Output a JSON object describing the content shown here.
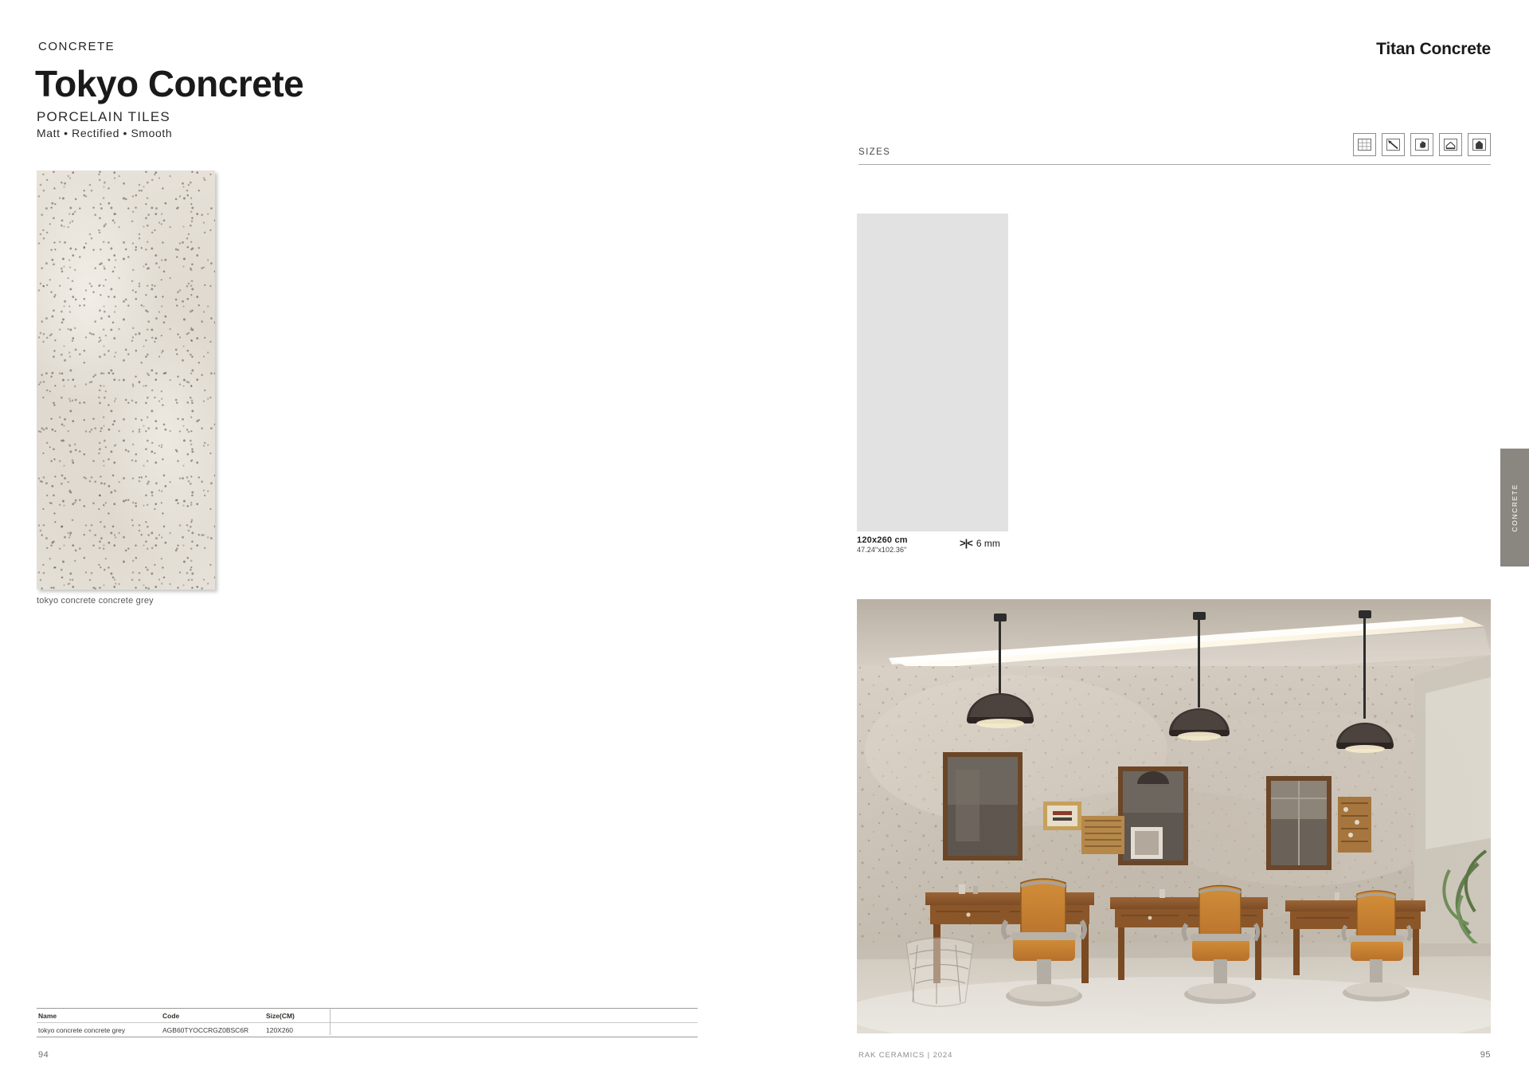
{
  "left_page": {
    "eyebrow": "CONCRETE",
    "title": "Tokyo Concrete",
    "product_type": "PORCELAIN TILES",
    "finish": "Matt • Rectified • Smooth",
    "swatch_caption": "tokyo  concrete concrete grey",
    "swatch_color": "#e3ded5",
    "table": {
      "headers": [
        "Name",
        "Code",
        "Size(CM)"
      ],
      "rows": [
        {
          "name": "tokyo concrete concrete grey",
          "code": "AGB60TYOCCRGZ0BSC6R",
          "size": "120X260"
        }
      ]
    },
    "folio": "94"
  },
  "right_page": {
    "brand_title": "Titan Concrete",
    "sizes_label": "SIZES",
    "icons": [
      {
        "name": "grid-pattern-icon",
        "title": "Sizes / Modular"
      },
      {
        "name": "rectified-edge-icon",
        "title": "Rectified"
      },
      {
        "name": "anti-slip-hand-icon",
        "title": "Surface Finish"
      },
      {
        "name": "floor-application-icon",
        "title": "Floor"
      },
      {
        "name": "wall-application-icon",
        "title": "Wall"
      }
    ],
    "size_swatch": {
      "color": "#e2e2e2",
      "metric": "120x260 cm",
      "imperial": "47.24\"x102.36\"",
      "thickness": "6 mm",
      "thickness_marker": ">|<"
    },
    "room_image": {
      "name": "barbershop-interior-photo",
      "alt": "Barber shop interior with concrete-look wall tiles, three pendant lamps, wooden counters, mirrors and vintage barber chairs"
    },
    "side_tab": {
      "label": "CONCRETE",
      "color": "#8a8781"
    },
    "folio": "95",
    "footer_brand": "RAK CERAMICS | 2024"
  }
}
